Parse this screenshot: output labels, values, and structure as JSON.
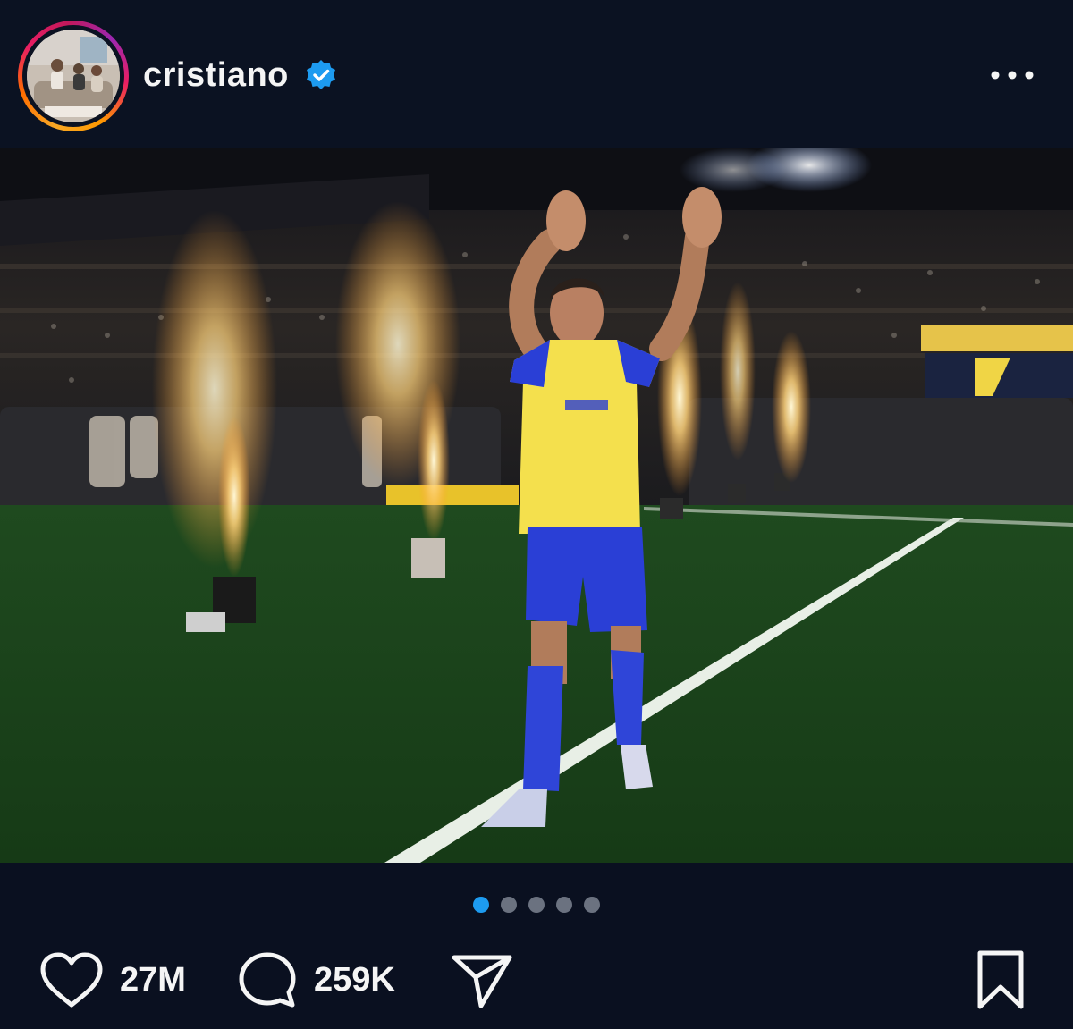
{
  "post": {
    "username": "cristiano",
    "verified_icon": "verified-badge-icon",
    "more_icon": "more-options-icon"
  },
  "media": {
    "carousel_total": 5,
    "carousel_active": 1
  },
  "actions": {
    "likes": "27M",
    "comments": "259K",
    "like_icon": "heart-icon",
    "comment_icon": "comment-bubble-icon",
    "share_icon": "send-icon",
    "save_icon": "bookmark-icon"
  },
  "colors": {
    "background": "#0a1020",
    "verified_blue": "#1d9bf0",
    "active_dot": "#1d9bf0",
    "inactive_dot": "#6b7280",
    "jersey_yellow": "#f4e04d",
    "jersey_blue": "#2a3fd6"
  }
}
